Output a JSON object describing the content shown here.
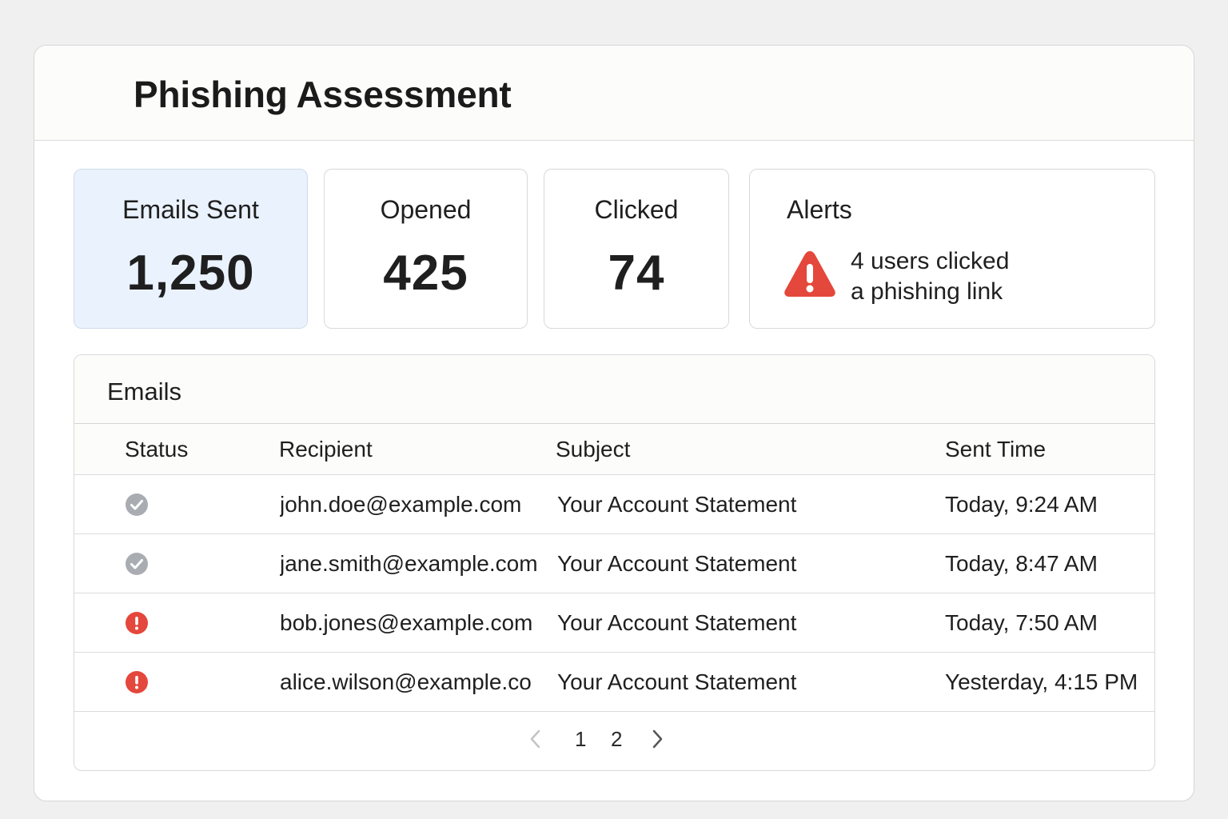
{
  "header": {
    "title": "Phishing Assessment"
  },
  "stats": [
    {
      "label": "Emails Sent",
      "value": "1,250"
    },
    {
      "label": "Opened",
      "value": "425"
    },
    {
      "label": "Clicked",
      "value": "74"
    }
  ],
  "alerts": {
    "label": "Alerts",
    "line1": "4 users clicked",
    "line2": "a phishing link",
    "icon": "warning-triangle-icon",
    "color": "#e4473b"
  },
  "emails": {
    "title": "Emails",
    "columns": [
      "Status",
      "Recipient",
      "Subject",
      "Sent Time"
    ],
    "rows": [
      {
        "status": "opened",
        "status_icon": "check-circle-icon",
        "recipient": "john.doe@example.com",
        "subject": "Your Account Statement",
        "sent_time": "Today, 9:24 AM"
      },
      {
        "status": "opened",
        "status_icon": "check-circle-icon",
        "recipient": "jane.smith@example.com",
        "subject": "Your Account Statement",
        "sent_time": "Today, 8:47 AM"
      },
      {
        "status": "clicked",
        "status_icon": "alert-circle-icon",
        "recipient": "bob.jones@example.com",
        "subject": "Your Account Statement",
        "sent_time": "Today, 7:50 AM"
      },
      {
        "status": "clicked",
        "status_icon": "alert-circle-icon",
        "recipient": "alice.wilson@example.co",
        "subject": "Your Account Statement",
        "sent_time": "Yesterday, 4:15 PM"
      }
    ]
  },
  "pagination": {
    "prev_icon": "chevron-left-icon",
    "next_icon": "chevron-right-icon",
    "pages": [
      "1",
      "2"
    ],
    "current": "1"
  },
  "colors": {
    "highlight_card": "#eaf2fd",
    "ok_status": "#a9adb2",
    "alert_status": "#e4473b"
  }
}
